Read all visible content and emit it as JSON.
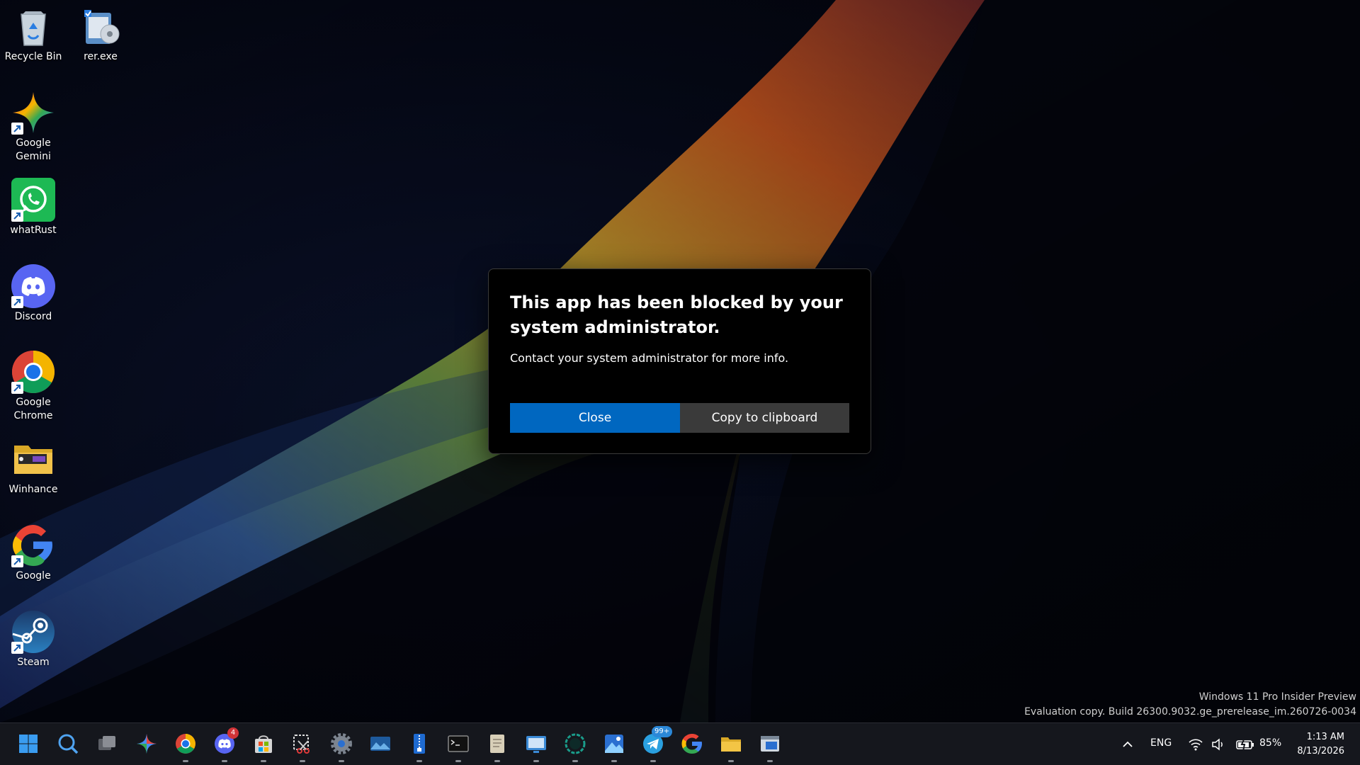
{
  "desktop": {
    "icons": [
      {
        "label": "Recycle Bin"
      },
      {
        "label": "rer.exe"
      },
      {
        "label": "Google Gemini"
      },
      {
        "label": "whatRust"
      },
      {
        "label": "Discord"
      },
      {
        "label": "Google Chrome"
      },
      {
        "label": "Winhance"
      },
      {
        "label": "Google"
      },
      {
        "label": "Steam"
      }
    ]
  },
  "dialog": {
    "title": "This app has been blocked by your system administrator.",
    "message": "Contact your system administrator for more info.",
    "close_label": "Close",
    "copy_label": "Copy to clipboard",
    "accent": "#0067c0"
  },
  "watermark": {
    "line1": "Windows 11 Pro Insider Preview",
    "line2": "Evaluation copy. Build 26300.9032.ge_prerelease_im.260726-0034"
  },
  "taskbar": {
    "apps": [
      {
        "icon": "windows-start-icon"
      },
      {
        "icon": "search-icon"
      },
      {
        "icon": "task-view-icon"
      },
      {
        "icon": "gemini-icon"
      },
      {
        "icon": "chrome-icon"
      },
      {
        "icon": "discord-icon",
        "badge": "4"
      },
      {
        "icon": "store-icon"
      },
      {
        "icon": "snipping-tool-icon"
      },
      {
        "icon": "settings-icon"
      },
      {
        "icon": "photos-icon"
      },
      {
        "icon": "archive-icon"
      },
      {
        "icon": "terminal-icon"
      },
      {
        "icon": "notepad-icon"
      },
      {
        "icon": "remote-desktop-icon"
      },
      {
        "icon": "circle-app-icon"
      },
      {
        "icon": "image-viewer-icon"
      },
      {
        "icon": "telegram-icon",
        "badge": "99+"
      },
      {
        "icon": "google-icon"
      },
      {
        "icon": "file-explorer-icon"
      },
      {
        "icon": "window-app-icon"
      }
    ],
    "tray": {
      "language": "ENG",
      "battery": "85%",
      "time": "1:13 AM",
      "date": "8/13/2026"
    }
  }
}
